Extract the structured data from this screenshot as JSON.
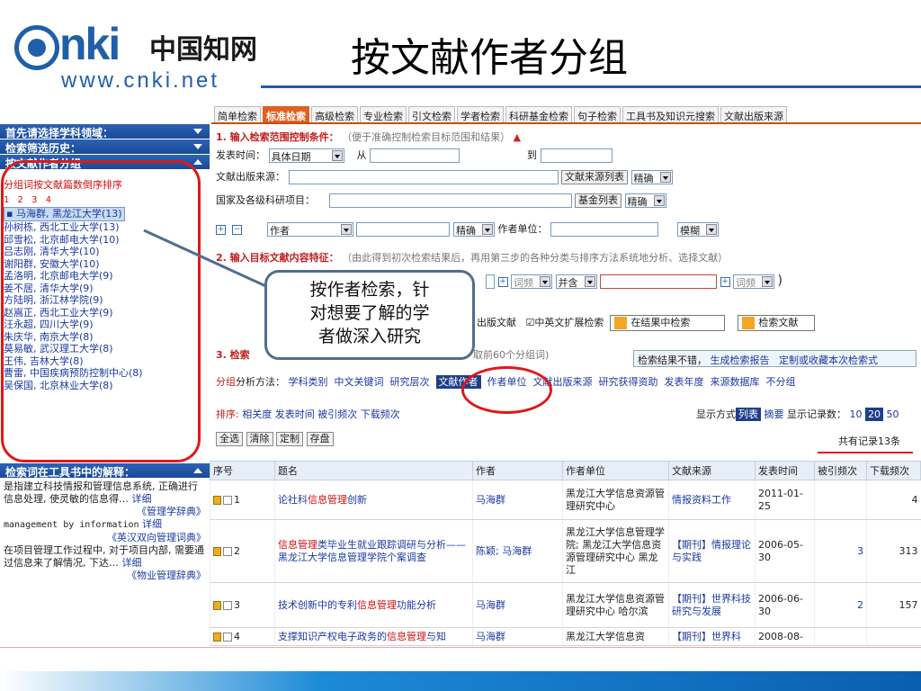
{
  "header": {
    "logo_nki": "nki",
    "logo_cn": "中国知网",
    "logo_url": "www.cnki.net",
    "slide_title": "按文献作者分组"
  },
  "tabs": [
    "简单检索",
    "标准检索",
    "高级检索",
    "专业检索",
    "引文检索",
    "学者检索",
    "科研基金检索",
    "句子检索",
    "工具书及知识元搜索",
    "文献出版来源"
  ],
  "active_tab": "标准检索",
  "sidebar": {
    "h1": "首先请选择学科领域：",
    "h2": "检索筛选历史：",
    "h3": "按文献作者分组",
    "sort_label": "分组词按文献篇数倒序排序",
    "pages": "1 2 3 4",
    "authors": [
      "马海群, 黑龙江大学(13)",
      "孙树栋, 西北工业大学(13)",
      "邱雪松, 北京邮电大学(10)",
      "吕志刚, 清华大学(10)",
      "谢阳群, 安徽大学(10)",
      "孟洛明, 北京邮电大学(9)",
      "姜不居, 清华大学(9)",
      "方陆明, 浙江林学院(9)",
      "赵嵩正, 西北工业大学(9)",
      "汪永超, 四川大学(9)",
      "朱庆华, 南京大学(8)",
      "莫易敏, 武汉理工大学(8)",
      "王伟, 吉林大学(8)",
      "曹雷, 中国疾病预防控制中心(8)",
      "吴保国, 北京林业大学(8)"
    ],
    "h4": "检索词在工具书中的解释：",
    "help": {
      "p1": "是指建立科技情报和管理信息系统, 正确进行信息处理, 使灵敏的信息得…",
      "p1_link": "详细",
      "p1_src": "《管理学辞典》",
      "p2": "management by information",
      "p2_link": "详细",
      "p2_src": "《英汉双向管理词典》",
      "p3": "在项目管理工作过程中, 对于项目内部, 需要通过信息来了解情况, 下达…",
      "p3_link": "详细",
      "p3_src": "《物业管理辞典》"
    }
  },
  "form": {
    "step1_title": "1. 输入检索范围控制条件：",
    "step1_note": "（便于准确控制检索目标范围和结果）",
    "pub_time": "发表时间：",
    "pub_time_sel": "具体日期",
    "from": "从",
    "to": "到",
    "source": "文献出版来源：",
    "source_btn": "文献来源列表",
    "exact": "精确",
    "fund": "国家及各级科研项目：",
    "fund_btn": "基金列表",
    "author_sel": "作者",
    "unit": "作者单位：",
    "fuzzy": "模糊",
    "step2_title": "2. 输入目标文献内容特征：",
    "step2_note": "（由此得到初次检索结果后，再用第三步的各种分类与排序方法系统地分析、选择文献）",
    "freq": "词频",
    "and": "并含",
    "paren": ")",
    "pub_doc": "出版文献",
    "ext": "中英文扩展检索",
    "search_in": "在结果中检索",
    "search_btn": "检索文献",
    "step3_prefix": "3. 检索",
    "step3_note": "取前60个分组词)",
    "report_text": "检索结果不错，",
    "report_link1": "生成检索报告",
    "report_link2": "定制或收藏本次检索式",
    "group_label": "分组",
    "group_method": "分析方法：",
    "group_opts": [
      "学科类别",
      "中文关键词",
      "研究层次",
      "文献作者",
      "作者单位",
      "文献出版来源",
      "研究获得资助",
      "发表年度",
      "来源数据库",
      "不分组"
    ],
    "active_group": "文献作者",
    "sort_label": "排序:",
    "sort_opts": [
      "相关度",
      "发表时间",
      "被引频次",
      "下载频次"
    ],
    "display_mode": "显示方式",
    "list": "列表",
    "summary": "摘要",
    "per_page": "显示记录数：",
    "pp_opts": [
      "10",
      "20",
      "50"
    ],
    "pp_active": "20",
    "btn_all": "全选",
    "btn_clear": "清除",
    "btn_custom": "定制",
    "btn_save": "存盘",
    "total": "共有记录13条"
  },
  "callout": {
    "line1": "按作者检索，针",
    "line2": "对想要了解的学",
    "line3": "者做深入研究"
  },
  "table": {
    "headers": [
      "序号",
      "题名",
      "作者",
      "作者单位",
      "文献来源",
      "发表时间",
      "被引频次",
      "下载频次"
    ],
    "rows": [
      {
        "no": "1",
        "title_a": "论社科",
        "title_hl": "信息管理",
        "title_b": "创新",
        "author": "马海群",
        "unit": "黑龙江大学信息资源管理研究中心",
        "source": "情报资料工作",
        "date": "2011-01-25",
        "cited": "",
        "dl": "4"
      },
      {
        "no": "2",
        "title_a": "",
        "title_hl": "信息管理",
        "title_b": "类毕业生就业跟踪调研与分析——黑龙江大学信息管理学院个案调查",
        "author": "陈颖; 马海群",
        "unit": "黑龙江大学信息管理学院; 黑龙江大学信息资源管理研究中心 黑龙江",
        "source": "【期刊】情报理论与实践",
        "date": "2006-05-30",
        "cited": "3",
        "dl": "313"
      },
      {
        "no": "3",
        "title_a": "技术创新中的专利",
        "title_hl": "信息管理",
        "title_b": "功能分析",
        "author": "马海群",
        "unit": "黑龙江大学信息资源管理研究中心 哈尔滨",
        "source": "【期刊】世界科技研究与发展",
        "date": "2006-06-30",
        "cited": "2",
        "dl": "157"
      },
      {
        "no": "4",
        "title_a": "支撑知识产权电子政务的",
        "title_hl": "信息管理",
        "title_b": "与知",
        "author": "马海群",
        "unit": "黑龙江大学信息资",
        "source": "【期刊】世界科",
        "date": "2008-08-",
        "cited": "",
        "dl": ""
      }
    ]
  }
}
